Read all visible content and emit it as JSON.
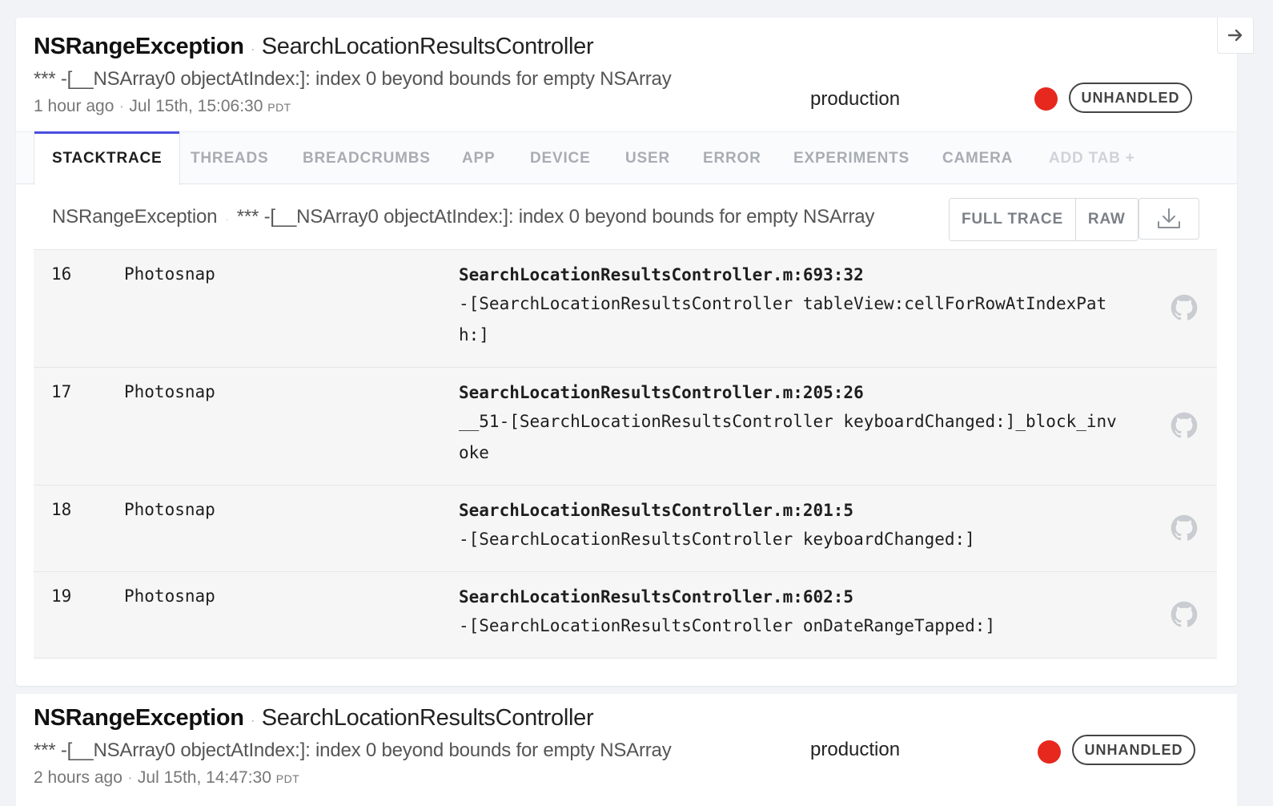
{
  "event": {
    "error_class": "NSRangeException",
    "context": "SearchLocationResultsController",
    "message": "*** -[__NSArray0 objectAtIndex:]: index 0 beyond bounds for empty NSArray",
    "relative_time": "1 hour ago",
    "absolute_time": "Jul 15th, 15:06:30",
    "timezone": "PDT",
    "environment": "production",
    "severity_color": "#e6281e",
    "status": "UNHANDLED"
  },
  "tabs": [
    {
      "label": "STACKTRACE",
      "active": true
    },
    {
      "label": "THREADS"
    },
    {
      "label": "BREADCRUMBS"
    },
    {
      "label": "APP"
    },
    {
      "label": "DEVICE"
    },
    {
      "label": "USER"
    },
    {
      "label": "ERROR"
    },
    {
      "label": "EXPERIMENTS"
    },
    {
      "label": "CAMERA"
    },
    {
      "label": "ADD TAB +"
    }
  ],
  "exception": {
    "class": "NSRangeException",
    "separator": "·",
    "message": "*** -[__NSArray0 objectAtIndex:]: index 0 beyond bounds for empty NSArray"
  },
  "toolbar": {
    "full_trace_label": "FULL TRACE",
    "raw_label": "RAW",
    "download_icon": "download-icon"
  },
  "frames": [
    {
      "number": "16",
      "module": "Photosnap",
      "location": "SearchLocationResultsController.m:693:32",
      "method": "-[SearchLocationResultsController tableView:cellForRowAtIndexPath:]"
    },
    {
      "number": "17",
      "module": "Photosnap",
      "location": "SearchLocationResultsController.m:205:26",
      "method": "__51-[SearchLocationResultsController keyboardChanged:]_block_invoke"
    },
    {
      "number": "18",
      "module": "Photosnap",
      "location": "SearchLocationResultsController.m:201:5",
      "method": "-[SearchLocationResultsController keyboardChanged:]"
    },
    {
      "number": "19",
      "module": "Photosnap",
      "location": "SearchLocationResultsController.m:602:5",
      "method": "-[SearchLocationResultsController onDateRangeTapped:]"
    }
  ],
  "next_event": {
    "error_class": "NSRangeException",
    "context": "SearchLocationResultsController",
    "message": "*** -[__NSArray0 objectAtIndex:]: index 0 beyond bounds for empty NSArray",
    "relative_time": "2 hours ago",
    "absolute_time": "Jul 15th, 14:47:30",
    "timezone": "PDT",
    "environment": "production",
    "severity_color": "#e6281e",
    "status": "UNHANDLED"
  }
}
